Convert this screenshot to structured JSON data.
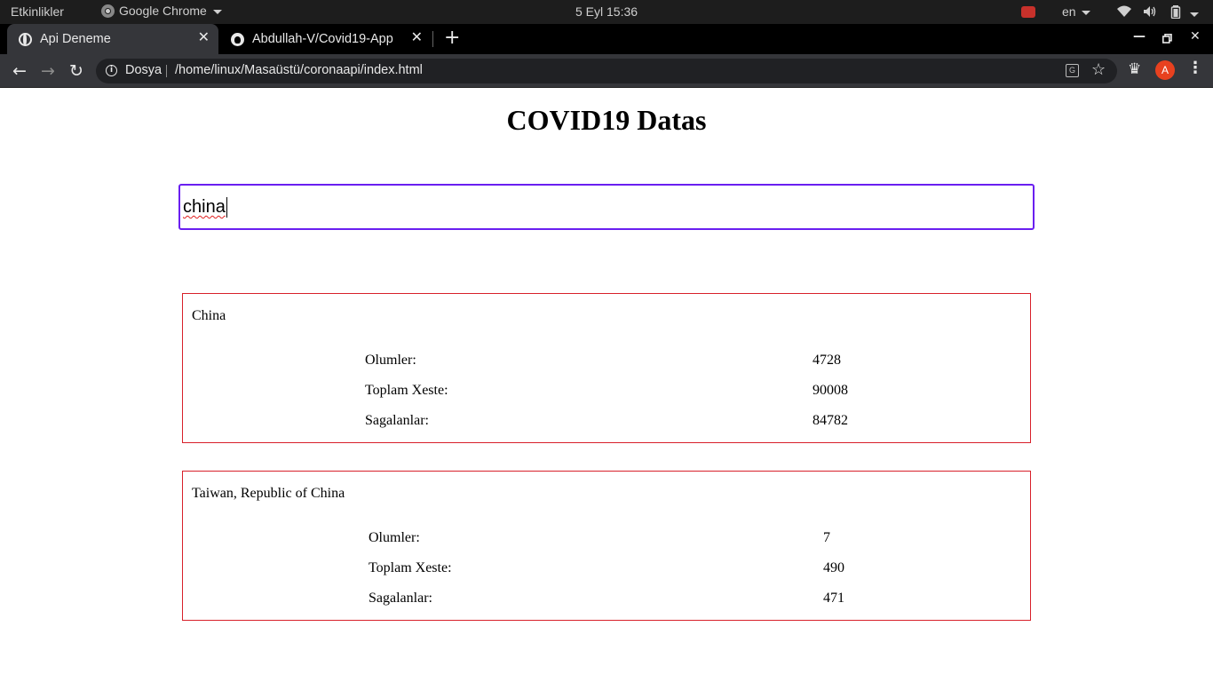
{
  "system_bar": {
    "activities": "Etkinlikler",
    "app_name": "Google Chrome",
    "datetime": "5 Eyl  15:36",
    "language": "en"
  },
  "browser": {
    "tabs": [
      {
        "title": "Api Deneme",
        "active": true
      },
      {
        "title": "Abdullah-V/Covid19-App",
        "active": false
      }
    ],
    "address": {
      "scheme_label": "Dosya",
      "url": "/home/linux/Masaüstü/coronaapi/index.html"
    },
    "profile_initial": "A"
  },
  "page": {
    "title": "COVID19 Datas",
    "search_value": "china",
    "results": [
      {
        "country": "China",
        "stats": [
          {
            "label": "Olumler:",
            "value": "4728"
          },
          {
            "label": "Toplam Xeste:",
            "value": "90008"
          },
          {
            "label": "Sagalanlar:",
            "value": "84782"
          }
        ]
      },
      {
        "country": "Taiwan, Republic of China",
        "stats": [
          {
            "label": "Olumler:",
            "value": "7"
          },
          {
            "label": "Toplam Xeste:",
            "value": "490"
          },
          {
            "label": "Sagalanlar:",
            "value": "471"
          }
        ]
      }
    ]
  },
  "colors": {
    "search_border": "#6a1ff0",
    "card_border": "#d8202a",
    "tab_active_bg": "#35363a",
    "avatar_bg": "#e8411f"
  }
}
